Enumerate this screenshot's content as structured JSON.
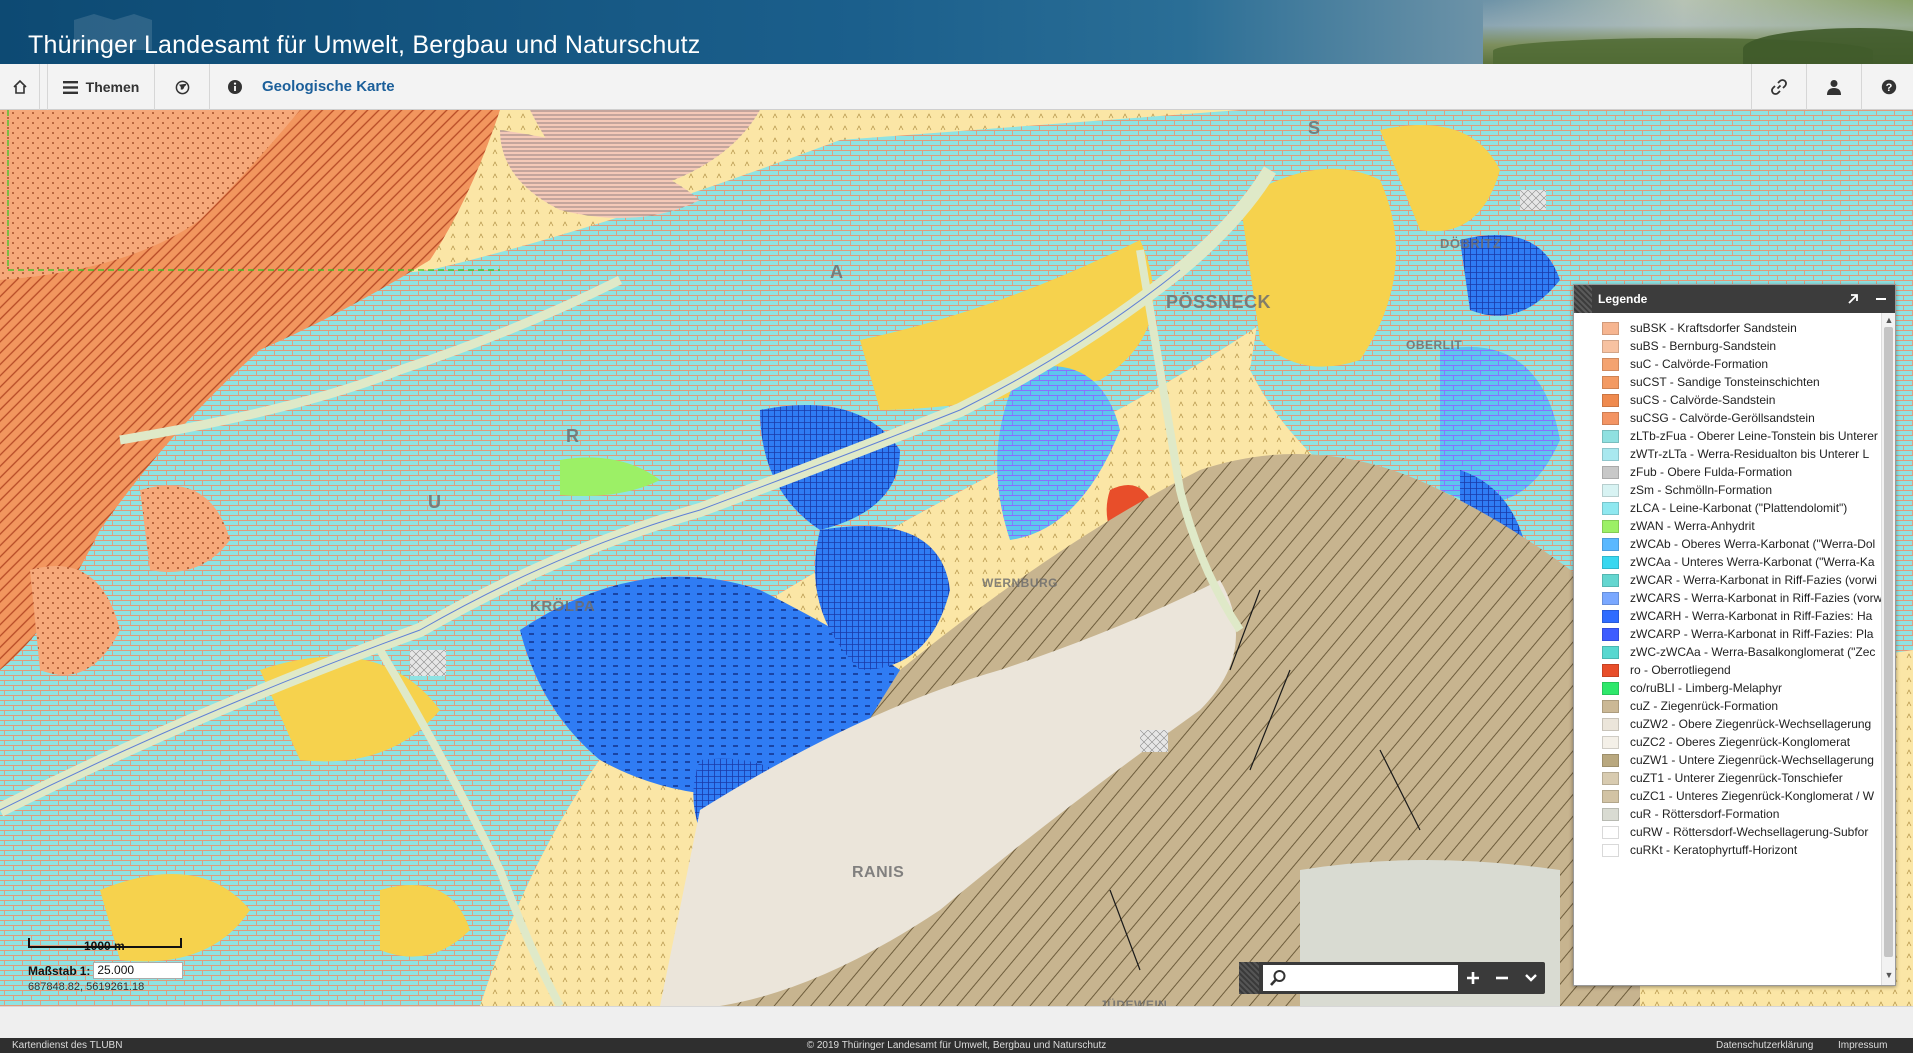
{
  "header": {
    "title": "Thüringer Landesamt für Umwelt, Bergbau und Naturschutz"
  },
  "toolbar": {
    "home_icon": "home-icon",
    "themen_label": "Themen",
    "globe_icon": "globe-icon",
    "info_icon": "info-icon",
    "map_title": "Geologische Karte",
    "link_icon": "link-icon",
    "user_icon": "user-icon",
    "help_icon": "help-icon"
  },
  "map": {
    "places": [
      "S",
      "PÖSSNECK",
      "KRÖLPA",
      "RANIS",
      "WERNBURG",
      "JÜDEWEIN",
      "OBERLIT",
      "DÖBRITZ",
      "A",
      "R",
      "U"
    ],
    "scale_bar_label": "1000 m",
    "massstab_label": "Maßstab",
    "massstab_prefix": "1:",
    "massstab_value": "25.000",
    "coordinates": "687848.82, 5619261.18",
    "search_icon": "search-icon"
  },
  "legend": {
    "title": "Legende",
    "items": [
      {
        "label": "suBSK - Kraftsdorfer Sandstein",
        "color": "#f6b590"
      },
      {
        "label": "suBS - Bernburg-Sandstein",
        "color": "#f7c2a1"
      },
      {
        "label": "suC - Calvörde-Formation",
        "color": "#f4a370"
      },
      {
        "label": "suCST - Sandige Tonsteinschichten",
        "color": "#f39a62"
      },
      {
        "label": "suCS - Calvörde-Sandstein",
        "color": "#ef8a4e"
      },
      {
        "label": "suCSG - Calvörde-Geröllsandstein",
        "color": "#f39463"
      },
      {
        "label": "zLTb-zFua - Oberer Leine-Tonstein bis Unterer",
        "color": "#8fe0e0"
      },
      {
        "label": "zWTr-zLTa - Werra-Residualton bis Unterer L",
        "color": "#a9e8ef"
      },
      {
        "label": "zFub - Obere Fulda-Formation",
        "color": "#c8c8c8"
      },
      {
        "label": "zSm - Schmölln-Formation",
        "color": "#d8f3f3"
      },
      {
        "label": "zLCA - Leine-Karbonat (\"Plattendolomit\")",
        "color": "#8fe8f0"
      },
      {
        "label": "zWAN - Werra-Anhydrit",
        "color": "#9cf066"
      },
      {
        "label": "zWCAb - Oberes Werra-Karbonat (\"Werra-Dol",
        "color": "#5ab8ff"
      },
      {
        "label": "zWCAa - Unteres Werra-Karbonat (\"Werra-Ka",
        "color": "#39d7f0"
      },
      {
        "label": "zWCAR - Werra-Karbonat in Riff-Fazies (vorwi",
        "color": "#64d6d0"
      },
      {
        "label": "zWCARS - Werra-Karbonat in Riff-Fazies (vorw",
        "color": "#7aa8ff"
      },
      {
        "label": "zWCARH - Werra-Karbonat in Riff-Fazies:  Ha",
        "color": "#2f6cff"
      },
      {
        "label": "zWCARP - Werra-Karbonat in Riff-Fazies:  Pla",
        "color": "#3d5cff"
      },
      {
        "label": "zWC-zWCAa - Werra-Basalkonglomerat (\"Zec",
        "color": "#58d8d0"
      },
      {
        "label": "ro - Oberrotliegend",
        "color": "#e84e2a"
      },
      {
        "label": "co/ruBLI - Limberg-Melaphyr",
        "color": "#2ee86b"
      },
      {
        "label": "cuZ - Ziegenrück-Formation",
        "color": "#cbb895"
      },
      {
        "label": "cuZW2 - Obere Ziegenrück-Wechsellagerung",
        "color": "#ebe5da"
      },
      {
        "label": "cuZC2 - Oberes Ziegenrück-Konglomerat",
        "color": "#f4f0e8"
      },
      {
        "label": "cuZW1 - Untere Ziegenrück-Wechsellagerung",
        "color": "#b9a87f"
      },
      {
        "label": "cuZT1 - Unterer Ziegenrück-Tonschiefer",
        "color": "#d8cbb0"
      },
      {
        "label": "cuZC1 - Unteres Ziegenrück-Konglomerat / W",
        "color": "#d2c3a4"
      },
      {
        "label": "cuR - Röttersdorf-Formation",
        "color": "#d9dbd2"
      },
      {
        "label": "cuRW - Röttersdorf-Wechsellagerung-Subfor",
        "color": "#ffffff"
      },
      {
        "label": "cuRKt - Keratophyrtuff-Horizont",
        "color": "#ffffff"
      }
    ]
  },
  "footer": {
    "left": "Kartendienst des TLUBN",
    "center": "© 2019 Thüringer Landesamt für Umwelt, Bergbau und Naturschutz",
    "privacy": "Datenschutzerklärung",
    "imprint": "Impressum"
  }
}
